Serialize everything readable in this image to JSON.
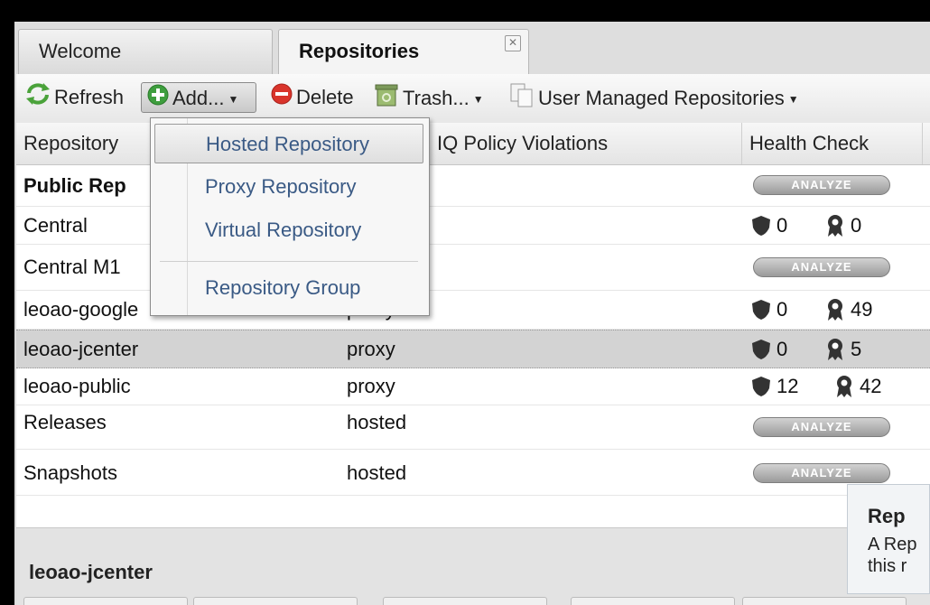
{
  "tabs": [
    {
      "label": "Welcome"
    },
    {
      "label": "Repositories",
      "close": "✕"
    }
  ],
  "toolbar": {
    "refresh": "Refresh",
    "add": "Add...",
    "delete": "Delete",
    "trash": "Trash...",
    "user_managed": "User Managed Repositories"
  },
  "grid": {
    "columns": [
      "Repository",
      "IQ Policy Violations",
      "Health Check"
    ],
    "analyze_label": "ANALYZE",
    "rows": [
      {
        "name": "Public Rep",
        "type": "",
        "health": "analyze"
      },
      {
        "name": "Central",
        "type": "",
        "security": "0",
        "license": "0"
      },
      {
        "name": "Central M1",
        "type": "",
        "health": "analyze"
      },
      {
        "name": "leoao-google",
        "type": "proxy",
        "security": "0",
        "license": "49"
      },
      {
        "name": "leoao-jcenter",
        "type": "proxy",
        "security": "0",
        "license": "5",
        "selected": true
      },
      {
        "name": "leoao-public",
        "type": "proxy",
        "security": "12",
        "license": "42"
      },
      {
        "name": "Releases",
        "type": "hosted",
        "health": "analyze"
      },
      {
        "name": "Snapshots",
        "type": "hosted",
        "health": "analyze"
      }
    ]
  },
  "add_menu": {
    "items": [
      "Hosted Repository",
      "Proxy Repository",
      "Virtual Repository",
      "Repository Group"
    ]
  },
  "detail": {
    "title": "leoao-jcenter"
  },
  "info_panel": {
    "title": "Rep",
    "line1": "A Rep",
    "line2": "this r"
  },
  "colors": {
    "accent_menu_text": "#3a5a85",
    "delete_red": "#d9342b",
    "add_green": "#3e9e3e"
  }
}
